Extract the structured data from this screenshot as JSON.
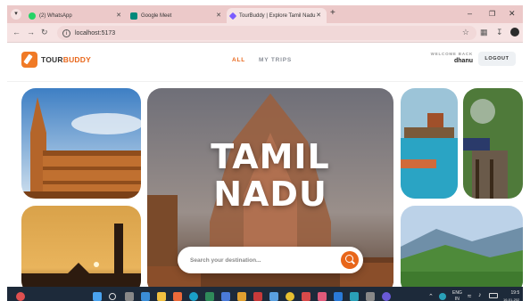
{
  "browser": {
    "tabs": [
      {
        "label": "(2) WhatsApp",
        "favicon": "whatsapp-icon",
        "color": "#25d366"
      },
      {
        "label": "Google Meet",
        "favicon": "meet-icon",
        "color": "#00897b"
      },
      {
        "label": "TourBuddy | Explore Tamil Nadu",
        "favicon": "vite-icon",
        "color": "#7b5cff",
        "active": true
      }
    ],
    "new_tab_glyph": "+",
    "address": "localhost:5173"
  },
  "site": {
    "logo": {
      "part1": "TOUR",
      "part2": "BUDDY"
    },
    "menu": [
      {
        "label": "ALL",
        "active": true
      },
      {
        "label": "MY TRIPS",
        "active": false
      }
    ],
    "welcome_label": "WELCOME BACK",
    "username": "dhanu",
    "logout_label": "LOGOUT"
  },
  "hero": {
    "title_line1": "TAMIL",
    "title_line2": "NADU",
    "search_placeholder": "Search your destination..."
  },
  "taskbar": {
    "lang_line1": "ENG",
    "lang_line2": "IN",
    "time": "19:5",
    "date": "16-01-202"
  },
  "colors": {
    "brand": "#e8661a",
    "accent_active_menu": "#e8661a"
  }
}
